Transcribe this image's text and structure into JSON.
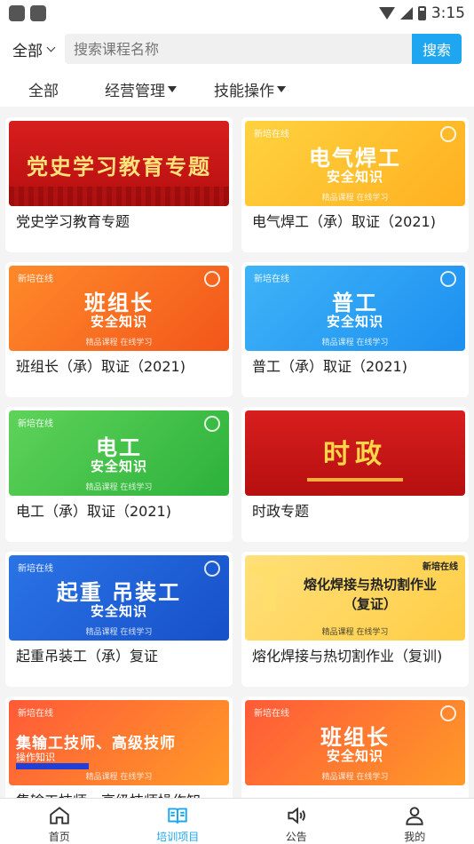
{
  "status_bar": {
    "time": "3:15"
  },
  "search": {
    "scope_label": "全部",
    "placeholder": "搜索课程名称",
    "button_label": "搜索"
  },
  "filters": {
    "all": "全部",
    "business": "经营管理",
    "skills": "技能操作"
  },
  "courses": [
    {
      "title": "党史学习教育专题",
      "thumb_text": "党史学习教育专题",
      "theme": "red"
    },
    {
      "title": "电气焊工（承）取证（2021)",
      "thumb_tag": "新培在线",
      "thumb_big": "电气焊工",
      "thumb_sub": "安全知识",
      "thumb_foot": "精品课程  在线学习",
      "theme": "yellow"
    },
    {
      "title": "班组长（承）取证（2021)",
      "thumb_tag": "新培在线",
      "thumb_big": "班组长",
      "thumb_sub": "安全知识",
      "thumb_foot": "精品课程  在线学习",
      "theme": "orange"
    },
    {
      "title": "普工（承）取证（2021)",
      "thumb_tag": "新培在线",
      "thumb_big": "普工",
      "thumb_sub": "安全知识",
      "thumb_foot": "精品课程  在线学习",
      "theme": "blue"
    },
    {
      "title": "电工（承）取证（2021)",
      "thumb_tag": "新培在线",
      "thumb_big": "电工",
      "thumb_sub": "安全知识",
      "thumb_foot": "精品课程  在线学习",
      "theme": "green"
    },
    {
      "title": "时政专题",
      "thumb_text": "时政",
      "theme": "red"
    },
    {
      "title": "起重吊装工（承）复证",
      "thumb_tag": "新培在线",
      "thumb_big": "起重 吊装工",
      "thumb_sub": "安全知识",
      "thumb_foot": "精品课程  在线学习",
      "theme": "deepblue"
    },
    {
      "title": "熔化焊接与热切割作业（复训)",
      "thumb_tag": "新培在线",
      "thumb_big": "熔化焊接与热切割作业",
      "thumb_sub": "（复证）",
      "thumb_foot": "精品课程  在线学习",
      "theme": "gold"
    },
    {
      "title": "集输工技师、高级技师操作知",
      "thumb_tag": "新培在线",
      "thumb_big": "集输工技师、高级技师",
      "thumb_sub": "操作知识",
      "thumb_foot": "精品课程  在线学习",
      "theme": "redorange"
    },
    {
      "title": "",
      "thumb_tag": "新培在线",
      "thumb_big": "班组长",
      "thumb_sub": "安全知识",
      "thumb_foot": "精品课程  在线学习",
      "theme": "redorange"
    }
  ],
  "bottom_nav": [
    {
      "label": "首页",
      "icon": "home-icon"
    },
    {
      "label": "培训项目",
      "icon": "book-icon",
      "active": true
    },
    {
      "label": "公告",
      "icon": "speaker-icon"
    },
    {
      "label": "我的",
      "icon": "user-icon"
    }
  ],
  "colors": {
    "accent": "#1ea7f0"
  }
}
